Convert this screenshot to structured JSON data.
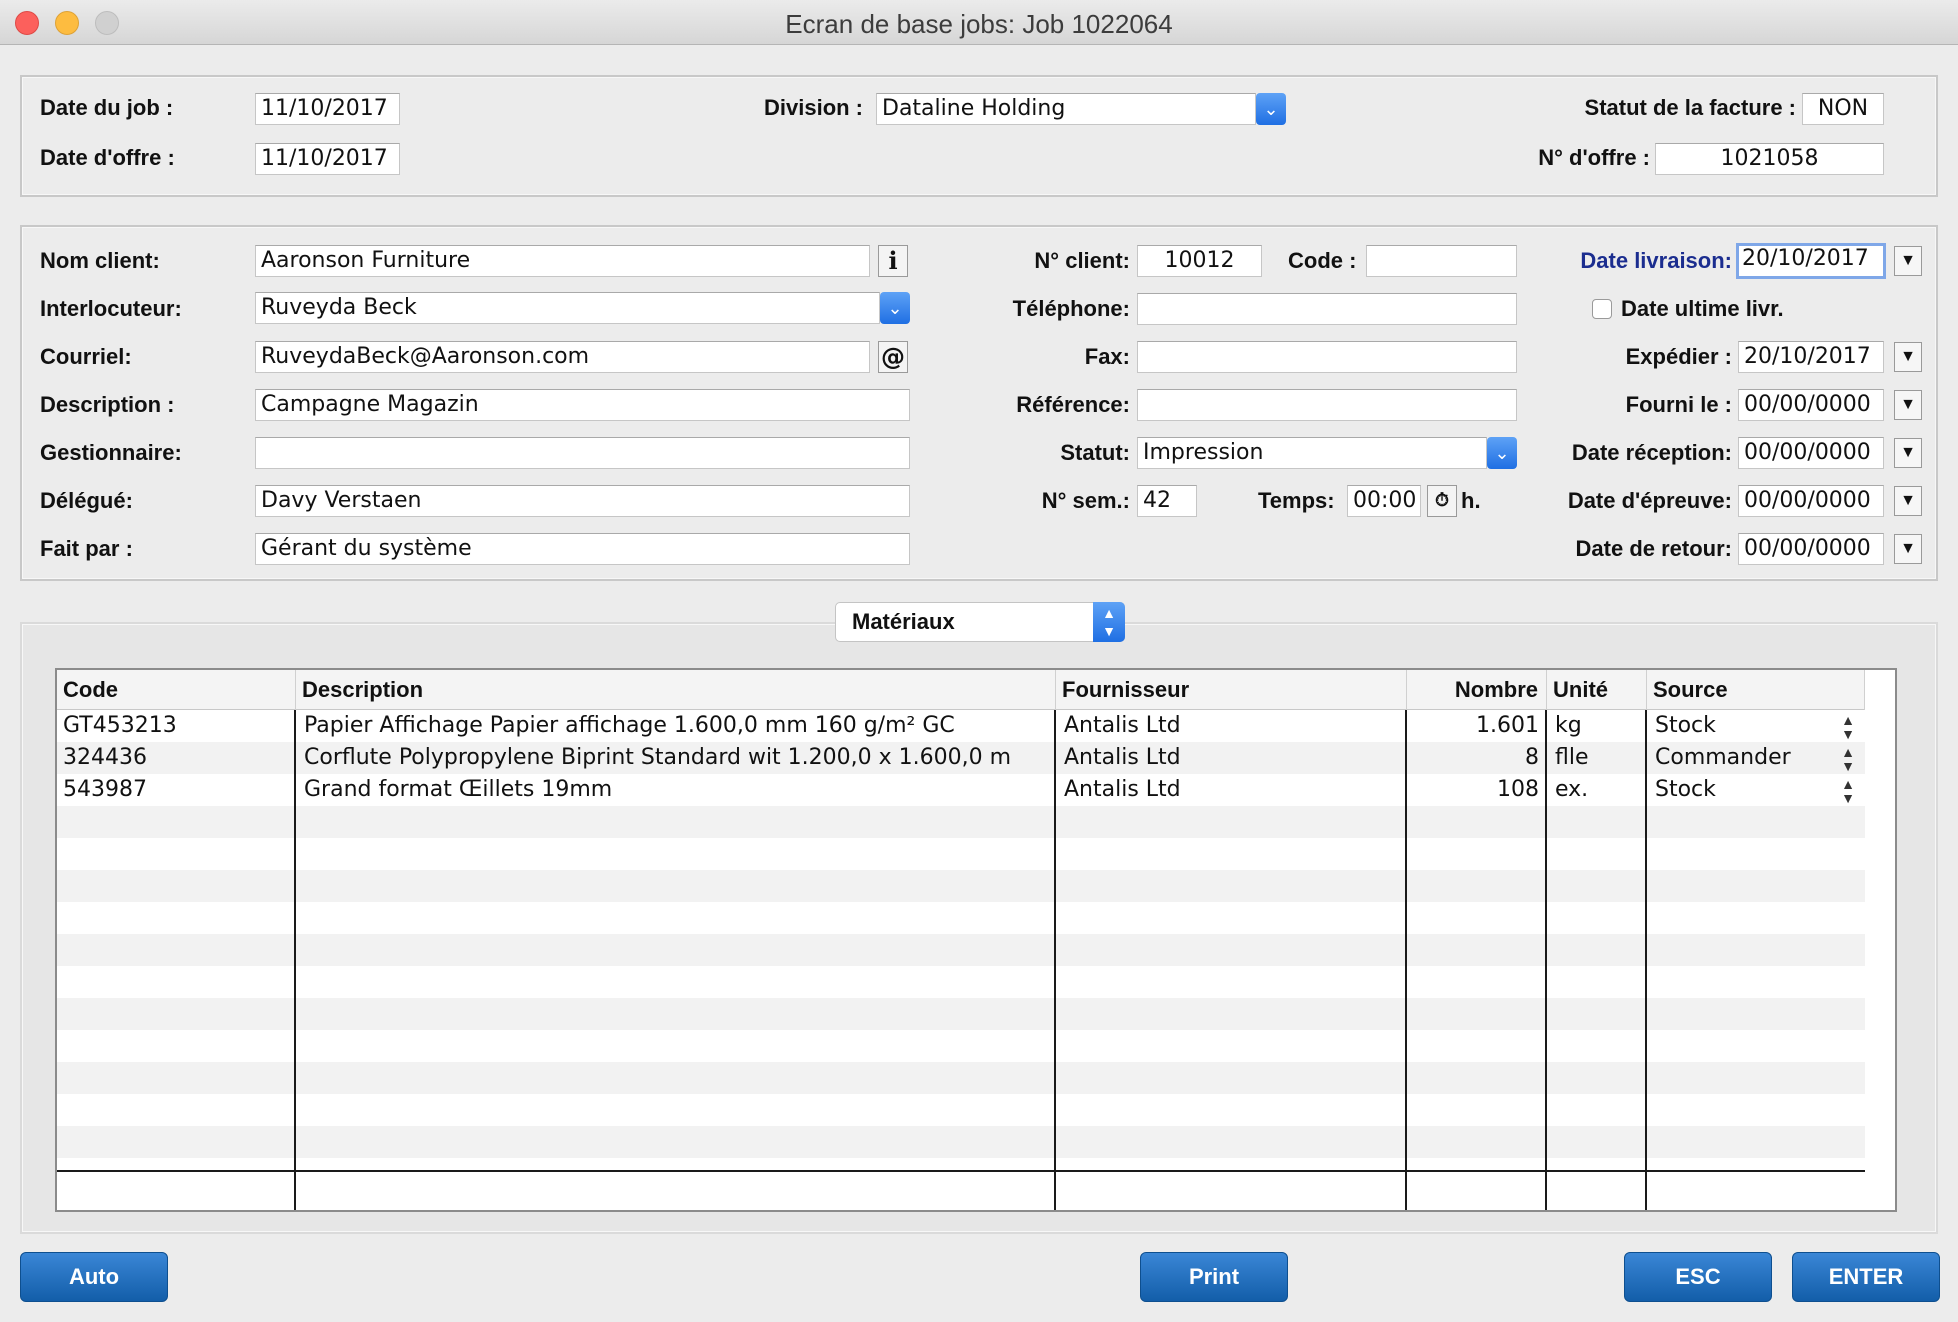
{
  "window": {
    "title": "Ecran de base jobs: Job 1022064"
  },
  "header": {
    "date_job_label": "Date du job :",
    "date_job": "11/10/2017",
    "date_offre_label": "Date d'offre :",
    "date_offre": "11/10/2017",
    "division_label": "Division :",
    "division": "Dataline Holding",
    "statut_facture_label": "Statut de la facture :",
    "statut_facture": "NON",
    "no_offre_label": "N° d'offre :",
    "no_offre": "1021058"
  },
  "client": {
    "nom_label": "Nom client:",
    "nom": "Aaronson Furniture",
    "interlocuteur_label": "Interlocuteur:",
    "interlocuteur": "Ruveyda Beck",
    "courriel_label": "Courriel:",
    "courriel": "RuveydaBeck@Aaronson.com",
    "description_label": "Description :",
    "description": "Campagne Magazin",
    "gestionnaire_label": "Gestionnaire:",
    "gestionnaire": "",
    "delegue_label": "Délégué:",
    "delegue": "Davy Verstaen",
    "fait_par_label": "Fait par :",
    "fait_par": "Gérant du système",
    "no_client_label": "N° client:",
    "no_client": "10012",
    "code_label": "Code :",
    "code": "",
    "telephone_label": "Téléphone:",
    "telephone": "",
    "fax_label": "Fax:",
    "fax": "",
    "reference_label": "Référence:",
    "reference": "",
    "statut_label": "Statut:",
    "statut": "Impression",
    "no_sem_label": "N° sem.:",
    "no_sem": "42",
    "temps_label": "Temps:",
    "temps": "00:00",
    "temps_unit": "h.",
    "info_icon": "i",
    "email_icon": "@"
  },
  "dates": {
    "date_livraison_label": "Date livraison:",
    "date_livraison": "20/10/2017",
    "date_ultime_label": "Date ultime livr.",
    "expedier_label": "Expédier :",
    "expedier": "20/10/2017",
    "fourni_le_label": "Fourni le :",
    "fourni_le": "00/00/0000",
    "date_reception_label": "Date réception:",
    "date_reception": "00/00/0000",
    "date_epreuve_label": "Date d'épreuve:",
    "date_epreuve": "00/00/0000",
    "date_retour_label": "Date de retour:",
    "date_retour": "00/00/0000"
  },
  "materials": {
    "selector": "Matériaux",
    "columns": [
      "Code",
      "Description",
      "Fournisseur",
      "Nombre",
      "Unité",
      "Source"
    ],
    "rows": [
      {
        "code": "GT453213",
        "description": "Papier Affichage Papier affichage 1.600,0 mm 160 g/m² GC",
        "fournisseur": "Antalis Ltd",
        "nombre": "1.601",
        "unite": "kg",
        "source": "Stock"
      },
      {
        "code": "324436",
        "description": "Corflute Polypropylene Biprint Standard wit 1.200,0 x 1.600,0 m",
        "fournisseur": "Antalis Ltd",
        "nombre": "8",
        "unite": "flle",
        "source": "Commander"
      },
      {
        "code": "543987",
        "description": "Grand format Œillets 19mm",
        "fournisseur": "Antalis Ltd",
        "nombre": "108",
        "unite": "ex.",
        "source": "Stock"
      }
    ]
  },
  "buttons": {
    "auto": "Auto",
    "print": "Print",
    "esc": "ESC",
    "enter": "ENTER"
  },
  "colors": {
    "accent": "#1f6fe3",
    "button": "#135ea9",
    "label_blue": "#1b2d8f"
  }
}
